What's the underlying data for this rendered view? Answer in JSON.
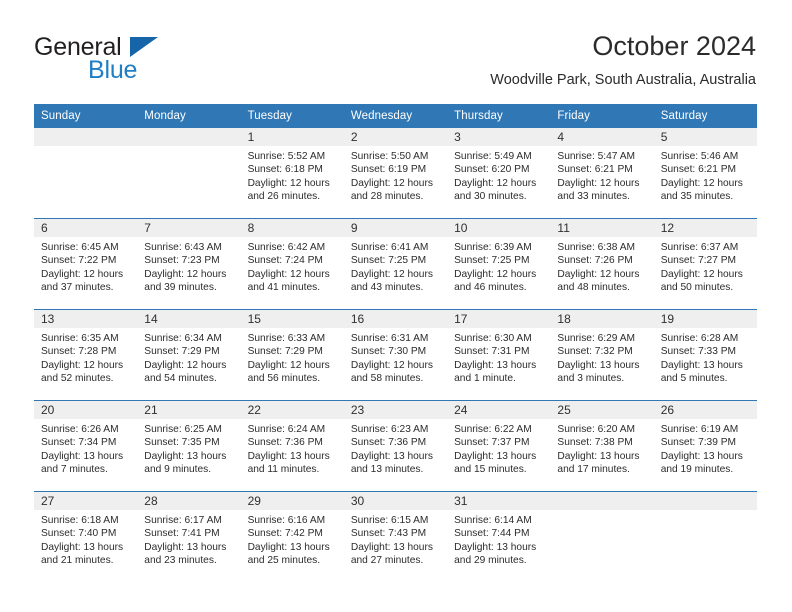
{
  "brand": {
    "name_part1": "General",
    "name_part2": "Blue",
    "flag_icon": "triangle-flag-icon"
  },
  "header": {
    "title": "October 2024",
    "subtitle": "Woodville Park, South Australia, Australia"
  },
  "colors": {
    "header_blue": "#2f77b5",
    "brand_blue": "#1f7ec4",
    "daynum_band": "#efefef",
    "text": "#2c2c2c"
  },
  "weekday_headers": [
    "Sunday",
    "Monday",
    "Tuesday",
    "Wednesday",
    "Thursday",
    "Friday",
    "Saturday"
  ],
  "weeks": [
    [
      {
        "day": "",
        "empty": true,
        "sunrise": "",
        "sunset": "",
        "daylight_1": "",
        "daylight_2": ""
      },
      {
        "day": "",
        "empty": true,
        "sunrise": "",
        "sunset": "",
        "daylight_1": "",
        "daylight_2": ""
      },
      {
        "day": "1",
        "empty": false,
        "sunrise": "Sunrise: 5:52 AM",
        "sunset": "Sunset: 6:18 PM",
        "daylight_1": "Daylight: 12 hours",
        "daylight_2": "and 26 minutes."
      },
      {
        "day": "2",
        "empty": false,
        "sunrise": "Sunrise: 5:50 AM",
        "sunset": "Sunset: 6:19 PM",
        "daylight_1": "Daylight: 12 hours",
        "daylight_2": "and 28 minutes."
      },
      {
        "day": "3",
        "empty": false,
        "sunrise": "Sunrise: 5:49 AM",
        "sunset": "Sunset: 6:20 PM",
        "daylight_1": "Daylight: 12 hours",
        "daylight_2": "and 30 minutes."
      },
      {
        "day": "4",
        "empty": false,
        "sunrise": "Sunrise: 5:47 AM",
        "sunset": "Sunset: 6:21 PM",
        "daylight_1": "Daylight: 12 hours",
        "daylight_2": "and 33 minutes."
      },
      {
        "day": "5",
        "empty": false,
        "sunrise": "Sunrise: 5:46 AM",
        "sunset": "Sunset: 6:21 PM",
        "daylight_1": "Daylight: 12 hours",
        "daylight_2": "and 35 minutes."
      }
    ],
    [
      {
        "day": "6",
        "empty": false,
        "sunrise": "Sunrise: 6:45 AM",
        "sunset": "Sunset: 7:22 PM",
        "daylight_1": "Daylight: 12 hours",
        "daylight_2": "and 37 minutes."
      },
      {
        "day": "7",
        "empty": false,
        "sunrise": "Sunrise: 6:43 AM",
        "sunset": "Sunset: 7:23 PM",
        "daylight_1": "Daylight: 12 hours",
        "daylight_2": "and 39 minutes."
      },
      {
        "day": "8",
        "empty": false,
        "sunrise": "Sunrise: 6:42 AM",
        "sunset": "Sunset: 7:24 PM",
        "daylight_1": "Daylight: 12 hours",
        "daylight_2": "and 41 minutes."
      },
      {
        "day": "9",
        "empty": false,
        "sunrise": "Sunrise: 6:41 AM",
        "sunset": "Sunset: 7:25 PM",
        "daylight_1": "Daylight: 12 hours",
        "daylight_2": "and 43 minutes."
      },
      {
        "day": "10",
        "empty": false,
        "sunrise": "Sunrise: 6:39 AM",
        "sunset": "Sunset: 7:25 PM",
        "daylight_1": "Daylight: 12 hours",
        "daylight_2": "and 46 minutes."
      },
      {
        "day": "11",
        "empty": false,
        "sunrise": "Sunrise: 6:38 AM",
        "sunset": "Sunset: 7:26 PM",
        "daylight_1": "Daylight: 12 hours",
        "daylight_2": "and 48 minutes."
      },
      {
        "day": "12",
        "empty": false,
        "sunrise": "Sunrise: 6:37 AM",
        "sunset": "Sunset: 7:27 PM",
        "daylight_1": "Daylight: 12 hours",
        "daylight_2": "and 50 minutes."
      }
    ],
    [
      {
        "day": "13",
        "empty": false,
        "sunrise": "Sunrise: 6:35 AM",
        "sunset": "Sunset: 7:28 PM",
        "daylight_1": "Daylight: 12 hours",
        "daylight_2": "and 52 minutes."
      },
      {
        "day": "14",
        "empty": false,
        "sunrise": "Sunrise: 6:34 AM",
        "sunset": "Sunset: 7:29 PM",
        "daylight_1": "Daylight: 12 hours",
        "daylight_2": "and 54 minutes."
      },
      {
        "day": "15",
        "empty": false,
        "sunrise": "Sunrise: 6:33 AM",
        "sunset": "Sunset: 7:29 PM",
        "daylight_1": "Daylight: 12 hours",
        "daylight_2": "and 56 minutes."
      },
      {
        "day": "16",
        "empty": false,
        "sunrise": "Sunrise: 6:31 AM",
        "sunset": "Sunset: 7:30 PM",
        "daylight_1": "Daylight: 12 hours",
        "daylight_2": "and 58 minutes."
      },
      {
        "day": "17",
        "empty": false,
        "sunrise": "Sunrise: 6:30 AM",
        "sunset": "Sunset: 7:31 PM",
        "daylight_1": "Daylight: 13 hours",
        "daylight_2": "and 1 minute."
      },
      {
        "day": "18",
        "empty": false,
        "sunrise": "Sunrise: 6:29 AM",
        "sunset": "Sunset: 7:32 PM",
        "daylight_1": "Daylight: 13 hours",
        "daylight_2": "and 3 minutes."
      },
      {
        "day": "19",
        "empty": false,
        "sunrise": "Sunrise: 6:28 AM",
        "sunset": "Sunset: 7:33 PM",
        "daylight_1": "Daylight: 13 hours",
        "daylight_2": "and 5 minutes."
      }
    ],
    [
      {
        "day": "20",
        "empty": false,
        "sunrise": "Sunrise: 6:26 AM",
        "sunset": "Sunset: 7:34 PM",
        "daylight_1": "Daylight: 13 hours",
        "daylight_2": "and 7 minutes."
      },
      {
        "day": "21",
        "empty": false,
        "sunrise": "Sunrise: 6:25 AM",
        "sunset": "Sunset: 7:35 PM",
        "daylight_1": "Daylight: 13 hours",
        "daylight_2": "and 9 minutes."
      },
      {
        "day": "22",
        "empty": false,
        "sunrise": "Sunrise: 6:24 AM",
        "sunset": "Sunset: 7:36 PM",
        "daylight_1": "Daylight: 13 hours",
        "daylight_2": "and 11 minutes."
      },
      {
        "day": "23",
        "empty": false,
        "sunrise": "Sunrise: 6:23 AM",
        "sunset": "Sunset: 7:36 PM",
        "daylight_1": "Daylight: 13 hours",
        "daylight_2": "and 13 minutes."
      },
      {
        "day": "24",
        "empty": false,
        "sunrise": "Sunrise: 6:22 AM",
        "sunset": "Sunset: 7:37 PM",
        "daylight_1": "Daylight: 13 hours",
        "daylight_2": "and 15 minutes."
      },
      {
        "day": "25",
        "empty": false,
        "sunrise": "Sunrise: 6:20 AM",
        "sunset": "Sunset: 7:38 PM",
        "daylight_1": "Daylight: 13 hours",
        "daylight_2": "and 17 minutes."
      },
      {
        "day": "26",
        "empty": false,
        "sunrise": "Sunrise: 6:19 AM",
        "sunset": "Sunset: 7:39 PM",
        "daylight_1": "Daylight: 13 hours",
        "daylight_2": "and 19 minutes."
      }
    ],
    [
      {
        "day": "27",
        "empty": false,
        "sunrise": "Sunrise: 6:18 AM",
        "sunset": "Sunset: 7:40 PM",
        "daylight_1": "Daylight: 13 hours",
        "daylight_2": "and 21 minutes."
      },
      {
        "day": "28",
        "empty": false,
        "sunrise": "Sunrise: 6:17 AM",
        "sunset": "Sunset: 7:41 PM",
        "daylight_1": "Daylight: 13 hours",
        "daylight_2": "and 23 minutes."
      },
      {
        "day": "29",
        "empty": false,
        "sunrise": "Sunrise: 6:16 AM",
        "sunset": "Sunset: 7:42 PM",
        "daylight_1": "Daylight: 13 hours",
        "daylight_2": "and 25 minutes."
      },
      {
        "day": "30",
        "empty": false,
        "sunrise": "Sunrise: 6:15 AM",
        "sunset": "Sunset: 7:43 PM",
        "daylight_1": "Daylight: 13 hours",
        "daylight_2": "and 27 minutes."
      },
      {
        "day": "31",
        "empty": false,
        "sunrise": "Sunrise: 6:14 AM",
        "sunset": "Sunset: 7:44 PM",
        "daylight_1": "Daylight: 13 hours",
        "daylight_2": "and 29 minutes."
      },
      {
        "day": "",
        "empty": true,
        "sunrise": "",
        "sunset": "",
        "daylight_1": "",
        "daylight_2": ""
      },
      {
        "day": "",
        "empty": true,
        "sunrise": "",
        "sunset": "",
        "daylight_1": "",
        "daylight_2": ""
      }
    ]
  ]
}
